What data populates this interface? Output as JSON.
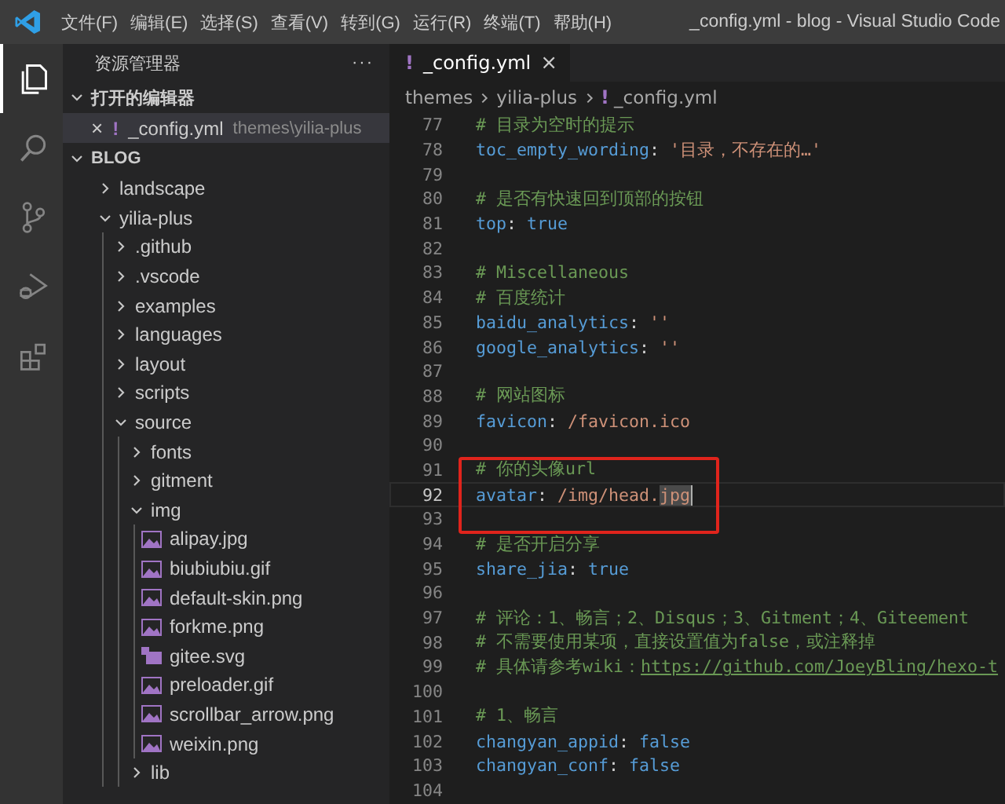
{
  "window": {
    "title": "_config.yml - blog - Visual Studio Code"
  },
  "menu": [
    "文件(F)",
    "编辑(E)",
    "选择(S)",
    "查看(V)",
    "转到(G)",
    "运行(R)",
    "终端(T)",
    "帮助(H)"
  ],
  "activity_bar": [
    {
      "kind": "explorer",
      "selected": true
    },
    {
      "kind": "search",
      "selected": false
    },
    {
      "kind": "source-control",
      "selected": false
    },
    {
      "kind": "run",
      "selected": false
    },
    {
      "kind": "extensions",
      "selected": false
    }
  ],
  "sidebar": {
    "title": "资源管理器",
    "more": "···",
    "open_editors": {
      "title": "打开的编辑器",
      "expanded": true,
      "items": [
        {
          "close": "×",
          "icon": "!",
          "name": "_config.yml",
          "path": "themes\\yilia-plus"
        }
      ]
    },
    "folder": {
      "title": "BLOG",
      "expanded": true,
      "items": [
        {
          "kind": "folder",
          "name": "landscape",
          "expanded": false
        },
        {
          "kind": "folder",
          "name": "yilia-plus",
          "expanded": true,
          "children": [
            {
              "kind": "folder",
              "name": ".github",
              "expanded": false
            },
            {
              "kind": "folder",
              "name": ".vscode",
              "expanded": false
            },
            {
              "kind": "folder",
              "name": "examples",
              "expanded": false
            },
            {
              "kind": "folder",
              "name": "languages",
              "expanded": false
            },
            {
              "kind": "folder",
              "name": "layout",
              "expanded": false
            },
            {
              "kind": "folder",
              "name": "scripts",
              "expanded": false
            },
            {
              "kind": "folder",
              "name": "source",
              "expanded": true,
              "children": [
                {
                  "kind": "folder",
                  "name": "fonts",
                  "expanded": false
                },
                {
                  "kind": "folder",
                  "name": "gitment",
                  "expanded": false
                },
                {
                  "kind": "folder",
                  "name": "img",
                  "expanded": true,
                  "children": [
                    {
                      "kind": "image",
                      "name": "alipay.jpg"
                    },
                    {
                      "kind": "image",
                      "name": "biubiubiu.gif"
                    },
                    {
                      "kind": "image",
                      "name": "default-skin.png"
                    },
                    {
                      "kind": "image",
                      "name": "forkme.png"
                    },
                    {
                      "kind": "svg",
                      "name": "gitee.svg"
                    },
                    {
                      "kind": "image",
                      "name": "preloader.gif"
                    },
                    {
                      "kind": "image",
                      "name": "scrollbar_arrow.png"
                    },
                    {
                      "kind": "image",
                      "name": "weixin.png"
                    }
                  ]
                },
                {
                  "kind": "folder",
                  "name": "lib",
                  "expanded": false
                }
              ]
            }
          ]
        }
      ]
    }
  },
  "tabs": [
    {
      "icon": "!",
      "label": "_config.yml",
      "close": "×",
      "selected": true
    }
  ],
  "breadcrumb": [
    {
      "text": "themes"
    },
    {
      "text": "yilia-plus"
    },
    {
      "icon": "!",
      "text": "_config.yml"
    }
  ],
  "code": {
    "lines": [
      {
        "number": "77",
        "current": false,
        "boxed": false,
        "tokens": [
          {
            "kind": "comment",
            "text": "# 目录为空时的提示"
          }
        ]
      },
      {
        "number": "78",
        "current": false,
        "boxed": false,
        "tokens": [
          {
            "kind": "key",
            "text": "toc_empty_wording"
          },
          {
            "kind": "punct",
            "text": ": "
          },
          {
            "kind": "string",
            "text": "'目录，不存在的…'"
          }
        ]
      },
      {
        "number": "79",
        "current": false,
        "boxed": false
      },
      {
        "number": "80",
        "current": false,
        "boxed": false,
        "tokens": [
          {
            "kind": "comment",
            "text": "# 是否有快速回到顶部的按钮"
          }
        ]
      },
      {
        "number": "81",
        "current": false,
        "boxed": false,
        "tokens": [
          {
            "kind": "key",
            "text": "top"
          },
          {
            "kind": "punct",
            "text": ": "
          },
          {
            "kind": "bool",
            "text": "true"
          }
        ]
      },
      {
        "number": "82",
        "current": false,
        "boxed": false
      },
      {
        "number": "83",
        "current": false,
        "boxed": false,
        "tokens": [
          {
            "kind": "comment",
            "text": "# Miscellaneous"
          }
        ]
      },
      {
        "number": "84",
        "current": false,
        "boxed": false,
        "tokens": [
          {
            "kind": "comment",
            "text": "# 百度统计"
          }
        ]
      },
      {
        "number": "85",
        "current": false,
        "boxed": false,
        "tokens": [
          {
            "kind": "key",
            "text": "baidu_analytics"
          },
          {
            "kind": "punct",
            "text": ": "
          },
          {
            "kind": "string",
            "text": "''"
          }
        ]
      },
      {
        "number": "86",
        "current": false,
        "boxed": false,
        "tokens": [
          {
            "kind": "key",
            "text": "google_analytics"
          },
          {
            "kind": "punct",
            "text": ": "
          },
          {
            "kind": "string",
            "text": "''"
          }
        ]
      },
      {
        "number": "87",
        "current": false,
        "boxed": false
      },
      {
        "number": "88",
        "current": false,
        "boxed": false,
        "tokens": [
          {
            "kind": "comment",
            "text": "# 网站图标"
          }
        ]
      },
      {
        "number": "89",
        "current": false,
        "boxed": false,
        "tokens": [
          {
            "kind": "key",
            "text": "favicon"
          },
          {
            "kind": "punct",
            "text": ": "
          },
          {
            "kind": "string",
            "text": "/favicon.ico"
          }
        ]
      },
      {
        "number": "90",
        "current": false,
        "boxed": false
      },
      {
        "number": "91",
        "current": false,
        "boxed": true,
        "tokens": [
          {
            "kind": "comment",
            "text": "# 你的头像url"
          }
        ]
      },
      {
        "number": "92",
        "current": true,
        "boxed": true,
        "tokens": [
          {
            "kind": "key",
            "text": "avatar"
          },
          {
            "kind": "punct",
            "text": ": "
          },
          {
            "kind": "string",
            "text": "/img/head."
          },
          {
            "kind": "selection",
            "text": "jpg"
          }
        ]
      },
      {
        "number": "93",
        "current": false,
        "boxed": true
      },
      {
        "number": "94",
        "current": false,
        "boxed": false,
        "tokens": [
          {
            "kind": "comment",
            "text": "# 是否开启分享"
          }
        ]
      },
      {
        "number": "95",
        "current": false,
        "boxed": false,
        "tokens": [
          {
            "kind": "key",
            "text": "share_jia"
          },
          {
            "kind": "punct",
            "text": ": "
          },
          {
            "kind": "bool",
            "text": "true"
          }
        ]
      },
      {
        "number": "96",
        "current": false,
        "boxed": false
      },
      {
        "number": "97",
        "current": false,
        "boxed": false,
        "tokens": [
          {
            "kind": "comment",
            "text": "# 评论：1、畅言；2、Disqus；3、Gitment；4、Giteement"
          }
        ]
      },
      {
        "number": "98",
        "current": false,
        "boxed": false,
        "tokens": [
          {
            "kind": "comment",
            "text": "# 不需要使用某项，直接设置值为false，或注释掉"
          }
        ]
      },
      {
        "number": "99",
        "current": false,
        "boxed": false,
        "tokens": [
          {
            "kind": "comment",
            "text": "# 具体请参考wiki："
          },
          {
            "kind": "link",
            "text": "https://github.com/JoeyBling/hexo-t"
          }
        ]
      },
      {
        "number": "100",
        "current": false,
        "boxed": false
      },
      {
        "number": "101",
        "current": false,
        "boxed": false,
        "tokens": [
          {
            "kind": "comment",
            "text": "# 1、畅言"
          }
        ]
      },
      {
        "number": "102",
        "current": false,
        "boxed": false,
        "tokens": [
          {
            "kind": "key",
            "text": "changyan_appid"
          },
          {
            "kind": "punct",
            "text": ": "
          },
          {
            "kind": "bool",
            "text": "false"
          }
        ]
      },
      {
        "number": "103",
        "current": false,
        "boxed": false,
        "tokens": [
          {
            "kind": "key",
            "text": "changyan_conf"
          },
          {
            "kind": "punct",
            "text": ": "
          },
          {
            "kind": "bool",
            "text": "false"
          }
        ]
      },
      {
        "number": "104",
        "current": false,
        "boxed": false
      }
    ]
  }
}
